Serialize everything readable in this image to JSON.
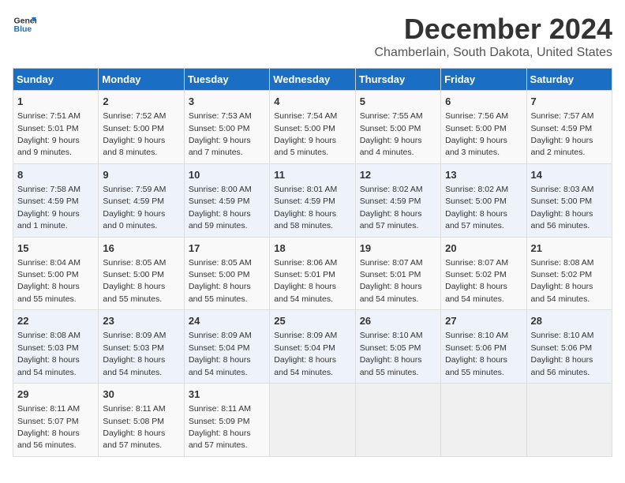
{
  "logo": {
    "line1": "General",
    "line2": "Blue"
  },
  "header": {
    "month": "December 2024",
    "location": "Chamberlain, South Dakota, United States"
  },
  "weekdays": [
    "Sunday",
    "Monday",
    "Tuesday",
    "Wednesday",
    "Thursday",
    "Friday",
    "Saturday"
  ],
  "weeks": [
    [
      {
        "day": "1",
        "info": "Sunrise: 7:51 AM\nSunset: 5:01 PM\nDaylight: 9 hours and 9 minutes."
      },
      {
        "day": "2",
        "info": "Sunrise: 7:52 AM\nSunset: 5:00 PM\nDaylight: 9 hours and 8 minutes."
      },
      {
        "day": "3",
        "info": "Sunrise: 7:53 AM\nSunset: 5:00 PM\nDaylight: 9 hours and 7 minutes."
      },
      {
        "day": "4",
        "info": "Sunrise: 7:54 AM\nSunset: 5:00 PM\nDaylight: 9 hours and 5 minutes."
      },
      {
        "day": "5",
        "info": "Sunrise: 7:55 AM\nSunset: 5:00 PM\nDaylight: 9 hours and 4 minutes."
      },
      {
        "day": "6",
        "info": "Sunrise: 7:56 AM\nSunset: 5:00 PM\nDaylight: 9 hours and 3 minutes."
      },
      {
        "day": "7",
        "info": "Sunrise: 7:57 AM\nSunset: 4:59 PM\nDaylight: 9 hours and 2 minutes."
      }
    ],
    [
      {
        "day": "8",
        "info": "Sunrise: 7:58 AM\nSunset: 4:59 PM\nDaylight: 9 hours and 1 minute."
      },
      {
        "day": "9",
        "info": "Sunrise: 7:59 AM\nSunset: 4:59 PM\nDaylight: 9 hours and 0 minutes."
      },
      {
        "day": "10",
        "info": "Sunrise: 8:00 AM\nSunset: 4:59 PM\nDaylight: 8 hours and 59 minutes."
      },
      {
        "day": "11",
        "info": "Sunrise: 8:01 AM\nSunset: 4:59 PM\nDaylight: 8 hours and 58 minutes."
      },
      {
        "day": "12",
        "info": "Sunrise: 8:02 AM\nSunset: 4:59 PM\nDaylight: 8 hours and 57 minutes."
      },
      {
        "day": "13",
        "info": "Sunrise: 8:02 AM\nSunset: 5:00 PM\nDaylight: 8 hours and 57 minutes."
      },
      {
        "day": "14",
        "info": "Sunrise: 8:03 AM\nSunset: 5:00 PM\nDaylight: 8 hours and 56 minutes."
      }
    ],
    [
      {
        "day": "15",
        "info": "Sunrise: 8:04 AM\nSunset: 5:00 PM\nDaylight: 8 hours and 55 minutes."
      },
      {
        "day": "16",
        "info": "Sunrise: 8:05 AM\nSunset: 5:00 PM\nDaylight: 8 hours and 55 minutes."
      },
      {
        "day": "17",
        "info": "Sunrise: 8:05 AM\nSunset: 5:00 PM\nDaylight: 8 hours and 55 minutes."
      },
      {
        "day": "18",
        "info": "Sunrise: 8:06 AM\nSunset: 5:01 PM\nDaylight: 8 hours and 54 minutes."
      },
      {
        "day": "19",
        "info": "Sunrise: 8:07 AM\nSunset: 5:01 PM\nDaylight: 8 hours and 54 minutes."
      },
      {
        "day": "20",
        "info": "Sunrise: 8:07 AM\nSunset: 5:02 PM\nDaylight: 8 hours and 54 minutes."
      },
      {
        "day": "21",
        "info": "Sunrise: 8:08 AM\nSunset: 5:02 PM\nDaylight: 8 hours and 54 minutes."
      }
    ],
    [
      {
        "day": "22",
        "info": "Sunrise: 8:08 AM\nSunset: 5:03 PM\nDaylight: 8 hours and 54 minutes."
      },
      {
        "day": "23",
        "info": "Sunrise: 8:09 AM\nSunset: 5:03 PM\nDaylight: 8 hours and 54 minutes."
      },
      {
        "day": "24",
        "info": "Sunrise: 8:09 AM\nSunset: 5:04 PM\nDaylight: 8 hours and 54 minutes."
      },
      {
        "day": "25",
        "info": "Sunrise: 8:09 AM\nSunset: 5:04 PM\nDaylight: 8 hours and 54 minutes."
      },
      {
        "day": "26",
        "info": "Sunrise: 8:10 AM\nSunset: 5:05 PM\nDaylight: 8 hours and 55 minutes."
      },
      {
        "day": "27",
        "info": "Sunrise: 8:10 AM\nSunset: 5:06 PM\nDaylight: 8 hours and 55 minutes."
      },
      {
        "day": "28",
        "info": "Sunrise: 8:10 AM\nSunset: 5:06 PM\nDaylight: 8 hours and 56 minutes."
      }
    ],
    [
      {
        "day": "29",
        "info": "Sunrise: 8:11 AM\nSunset: 5:07 PM\nDaylight: 8 hours and 56 minutes."
      },
      {
        "day": "30",
        "info": "Sunrise: 8:11 AM\nSunset: 5:08 PM\nDaylight: 8 hours and 57 minutes."
      },
      {
        "day": "31",
        "info": "Sunrise: 8:11 AM\nSunset: 5:09 PM\nDaylight: 8 hours and 57 minutes."
      },
      null,
      null,
      null,
      null
    ]
  ]
}
